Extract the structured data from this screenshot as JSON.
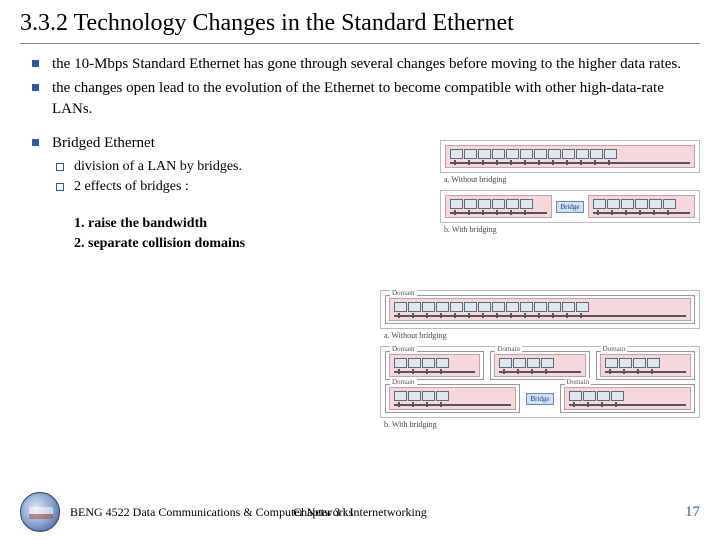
{
  "title": "3.3.2 Technology Changes in the Standard Ethernet",
  "bullets": [
    "the 10-Mbps Standard Ethernet has gone through several changes before moving to the higher data rates.",
    "the changes open lead to the evolution of the Ethernet to become compatible with other high-data-rate LANs."
  ],
  "sub_heading": "Bridged Ethernet",
  "sub_bullets": [
    "division of a LAN by bridges.",
    "2 effects of bridges :"
  ],
  "effects": {
    "e1": "1. raise the bandwidth",
    "e2": "2. separate collision domains"
  },
  "diagram_top": {
    "caption_a": "a. Without bridging",
    "caption_b": "b. With bridging",
    "bridge_label": "Bridge"
  },
  "diagram_bottom": {
    "domain_label": "Domain",
    "caption_a": "a. Without bridging",
    "caption_b": "b. With bridging",
    "bridge_label": "Bridge"
  },
  "footer": {
    "course": "BENG 4522 Data Communications & Computer Networks",
    "chapter": "Chapter 3 : Internetworking",
    "page": "17"
  }
}
